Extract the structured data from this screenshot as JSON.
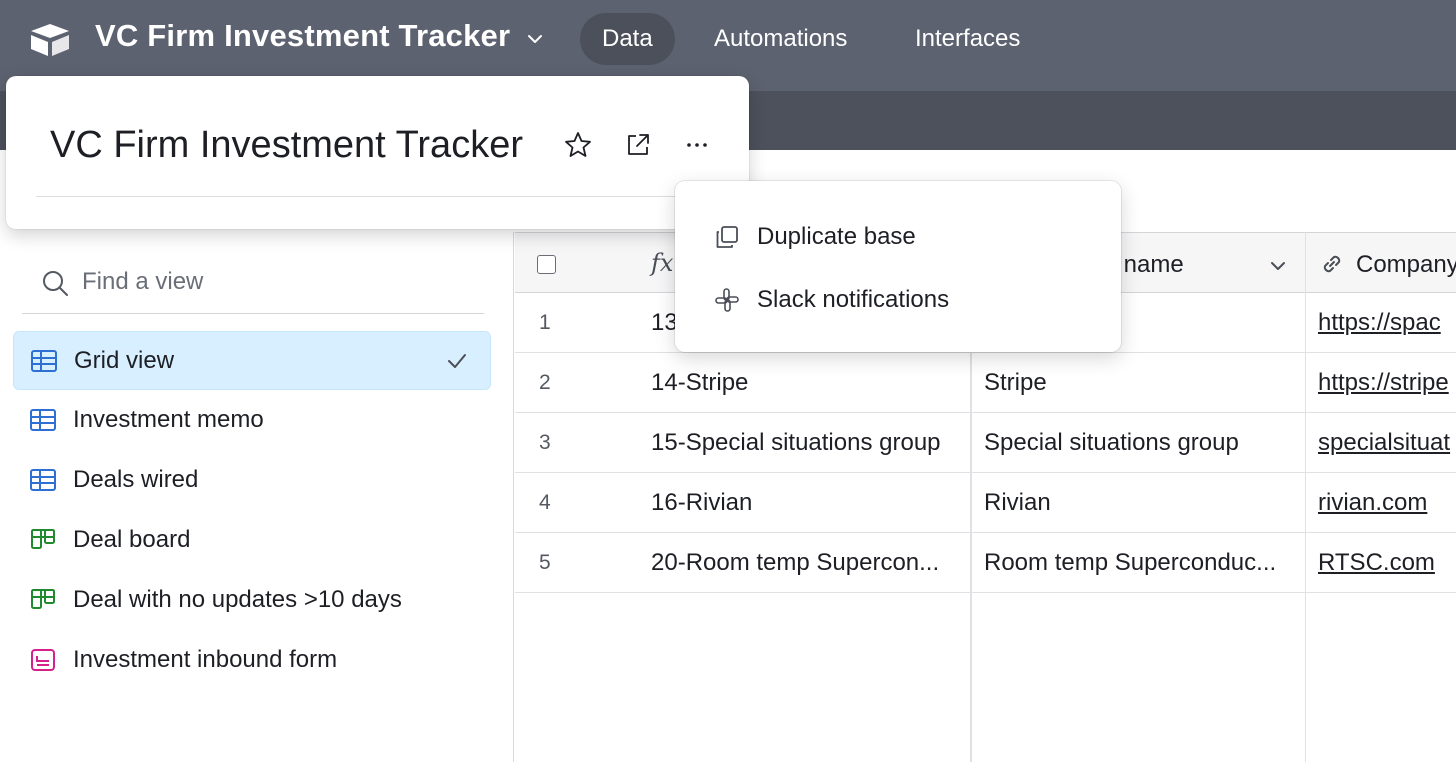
{
  "topbar": {
    "base_title": "VC Firm Investment Tracker",
    "tabs": [
      {
        "label": "Data",
        "active": true
      },
      {
        "label": "Automations",
        "active": false
      },
      {
        "label": "Interfaces",
        "active": false
      }
    ]
  },
  "base_popover": {
    "title": "VC Firm Investment Tracker",
    "icons": [
      "star-icon",
      "open-external-icon",
      "more-icon"
    ]
  },
  "menu": {
    "items": [
      {
        "label": "Duplicate base",
        "icon": "duplicate-icon"
      },
      {
        "label": "Slack notifications",
        "icon": "slack-icon"
      }
    ]
  },
  "sidebar": {
    "search_placeholder": "Find a view",
    "views": [
      {
        "label": "Grid view",
        "icon": "grid-icon",
        "selected": true
      },
      {
        "label": "Investment memo",
        "icon": "grid-icon",
        "selected": false
      },
      {
        "label": "Deals wired",
        "icon": "grid-icon",
        "selected": false
      },
      {
        "label": "Deal board",
        "icon": "kanban-icon",
        "selected": false
      },
      {
        "label": "Deal with no updates >10 days",
        "icon": "kanban-icon",
        "selected": false
      },
      {
        "label": "Investment inbound form",
        "icon": "form-icon",
        "selected": false
      }
    ]
  },
  "grid": {
    "headers": {
      "primary_icon": "fx",
      "name_partial": "y name",
      "company_partial": "Company"
    },
    "rows": [
      {
        "num": "1",
        "primary": "13",
        "name": "",
        "url": "https://spac"
      },
      {
        "num": "2",
        "primary": "14-Stripe",
        "name": "Stripe",
        "url": "https://stripe"
      },
      {
        "num": "3",
        "primary": "15-Special situations group",
        "name": "Special situations group",
        "url": "specialsituat"
      },
      {
        "num": "4",
        "primary": "16-Rivian",
        "name": "Rivian",
        "url": "rivian.com"
      },
      {
        "num": "5",
        "primary": "20-Room temp Supercon...",
        "name": "Room temp Superconduc...",
        "url": "RTSC.com"
      }
    ]
  },
  "colors": {
    "topbar": "#5d6270",
    "selected_view": "#d7efff",
    "grid_icon": "#2d6fd2",
    "kanban_icon": "#1f8a2e",
    "form_icon": "#d6218c"
  }
}
